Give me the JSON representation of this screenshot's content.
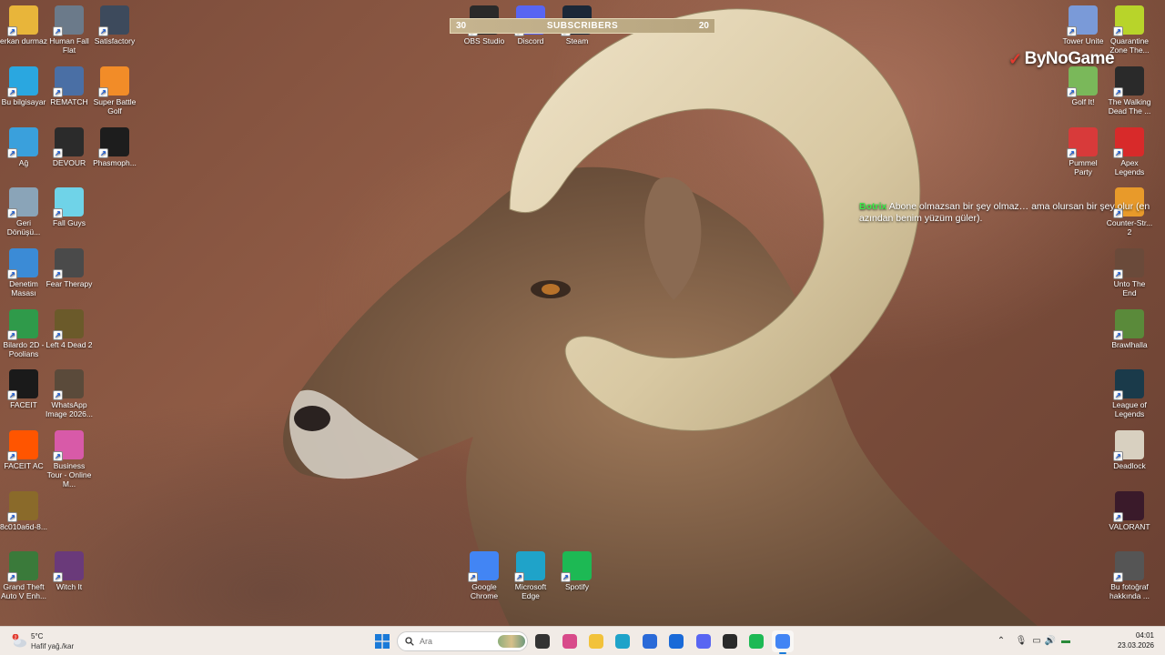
{
  "overlay": {
    "subscribers": {
      "left_count": "30",
      "label": "SUBSCRIBERS",
      "right_count": "20"
    },
    "brand": "ByNoGame",
    "chat": {
      "user": "Botrix",
      "message": "Abone olmazsan bir şey olmaz… ama olursan bir şey olur (en azından benim yüzüm güler)."
    }
  },
  "desktop": {
    "left_icons": [
      {
        "label": "erkan durmaz",
        "icon": "user-folder-icon",
        "color": "#e8b53a"
      },
      {
        "label": "Human Fall Flat",
        "icon": "human-fall-flat-icon",
        "color": "#6b7a8a"
      },
      {
        "label": "Satisfactory",
        "icon": "satisfactory-icon",
        "color": "#3d4a5c"
      },
      {
        "label": "Bu bilgisayar",
        "icon": "computer-icon",
        "color": "#2aa7e0"
      },
      {
        "label": "REMATCH",
        "icon": "rematch-icon",
        "color": "#4a6fa5"
      },
      {
        "label": "Super Battle Golf",
        "icon": "golf-ball-icon",
        "color": "#f28c28"
      },
      {
        "label": "Ağ",
        "icon": "network-icon",
        "color": "#3aa0dc"
      },
      {
        "label": "DEVOUR",
        "icon": "devour-icon",
        "color": "#2b2b2b"
      },
      {
        "label": "Phasmoph...",
        "icon": "phasmophobia-icon",
        "color": "#1d1d1d"
      },
      {
        "label": "Geri Dönüşü...",
        "icon": "recycle-bin-icon",
        "color": "#8aa4b8"
      },
      {
        "label": "Fall Guys",
        "icon": "fall-guys-icon",
        "color": "#6fd3e8"
      },
      {
        "label": "Denetim Masası",
        "icon": "control-panel-icon",
        "color": "#3b8bd6"
      },
      {
        "label": "Fear Therapy",
        "icon": "fear-therapy-icon",
        "color": "#4a4a4a"
      },
      {
        "label": "Bilardo 2D - Poolians",
        "icon": "billiards-icon",
        "color": "#2f9a4a"
      },
      {
        "label": "Left 4 Dead 2",
        "icon": "left4dead-icon",
        "color": "#6b5a2a"
      },
      {
        "label": "FACEIT",
        "icon": "faceit-icon",
        "color": "#1a1a1a"
      },
      {
        "label": "WhatsApp Image 2026...",
        "icon": "image-file-icon",
        "color": "#5a4a3a"
      },
      {
        "label": "FACEIT AC",
        "icon": "faceit-ac-icon",
        "color": "#ff5500"
      },
      {
        "label": "Business Tour - Online M...",
        "icon": "business-tour-icon",
        "color": "#d85aa8"
      },
      {
        "label": "8c010a6d-8...",
        "icon": "image-file-icon",
        "color": "#8a6a2a"
      },
      {
        "label": "Grand Theft Auto V Enh...",
        "icon": "gta-icon",
        "color": "#3a7a3a"
      },
      {
        "label": "Witch It",
        "icon": "witch-it-icon",
        "color": "#6a3a7a"
      }
    ],
    "top_center_icons": [
      {
        "label": "OBS Studio",
        "icon": "obs-icon",
        "color": "#2a2a2a"
      },
      {
        "label": "Discord",
        "icon": "discord-icon",
        "color": "#5865f2"
      },
      {
        "label": "Steam",
        "icon": "steam-icon",
        "color": "#1b2838"
      }
    ],
    "bottom_center_icons": [
      {
        "label": "Google Chrome",
        "icon": "chrome-icon",
        "color": "#4285f4"
      },
      {
        "label": "Microsoft Edge",
        "icon": "edge-icon",
        "color": "#1fa3c9"
      },
      {
        "label": "Spotify",
        "icon": "spotify-icon",
        "color": "#1db954"
      }
    ],
    "right_icons": [
      {
        "label": "Tower Unite",
        "icon": "tower-unite-icon",
        "color": "#7a9ad8"
      },
      {
        "label": "Quarantine Zone The...",
        "icon": "quarantine-zone-icon",
        "color": "#b8d42a"
      },
      {
        "label": "Golf It!",
        "icon": "golf-it-icon",
        "color": "#7ab85a"
      },
      {
        "label": "The Walking Dead The ...",
        "icon": "walking-dead-icon",
        "color": "#2a2a2a"
      },
      {
        "label": "Pummel Party",
        "icon": "pummel-party-icon",
        "color": "#d83a3a"
      },
      {
        "label": "Apex Legends",
        "icon": "apex-icon",
        "color": "#d82a2a"
      },
      {
        "label": "Counter-Str... 2",
        "icon": "counter-strike-icon",
        "color": "#e89a2a"
      },
      {
        "label": "Unto The End",
        "icon": "unto-the-end-icon",
        "color": "#6a4a3a"
      },
      {
        "label": "Brawlhalla",
        "icon": "brawlhalla-icon",
        "color": "#5a8a3a"
      },
      {
        "label": "League of Legends",
        "icon": "league-icon",
        "color": "#1a3a4a"
      },
      {
        "label": "Deadlock",
        "icon": "deadlock-icon",
        "color": "#d8d0c0"
      },
      {
        "label": "VALORANT",
        "icon": "valorant-icon",
        "color": "#3a1a2a"
      },
      {
        "label": "Bu fotoğraf hakkında ...",
        "icon": "camera-info-icon",
        "color": "#555555"
      }
    ]
  },
  "taskbar": {
    "weather": {
      "temp": "5°C",
      "desc": "Hafif yağ./kar",
      "badge": "2"
    },
    "search": {
      "placeholder": "Ara"
    },
    "apps": [
      {
        "icon": "start-icon",
        "color": "#1a7ad8"
      },
      {
        "icon": "task-view-icon",
        "color": "#333333"
      },
      {
        "icon": "widgets-icon",
        "color": "#d84a8a"
      },
      {
        "icon": "file-explorer-icon",
        "color": "#f2c23a"
      },
      {
        "icon": "edge-icon",
        "color": "#1fa3c9"
      },
      {
        "icon": "store-icon",
        "color": "#2a6ad8"
      },
      {
        "icon": "outlook-icon",
        "color": "#1a6ad8"
      },
      {
        "icon": "discord-icon",
        "color": "#5865f2"
      },
      {
        "icon": "obs-icon",
        "color": "#2a2a2a"
      },
      {
        "icon": "spotify-icon",
        "color": "#1db954"
      },
      {
        "icon": "chrome-icon",
        "color": "#4285f4"
      }
    ],
    "clock": {
      "time": "04:01",
      "date": "23.03.2026"
    }
  }
}
